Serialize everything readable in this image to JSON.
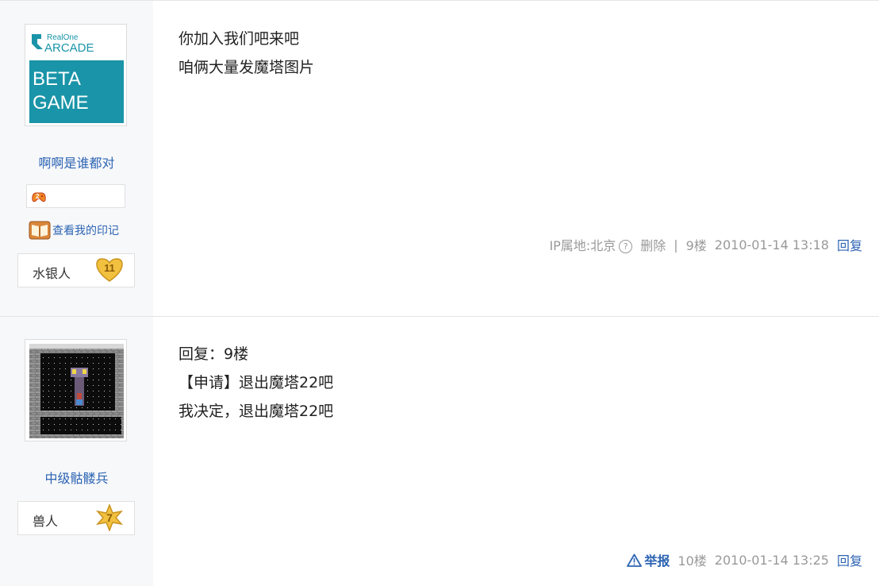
{
  "posts": [
    {
      "username": "啊啊是谁都对",
      "avatar": {
        "logo_line1": "RealOne",
        "logo_line2": "ARCADE",
        "line1": "BETA",
        "line2": "GAME"
      },
      "icon_count": "2",
      "stamp_link": "查看我的印记",
      "level_name": "水银人",
      "level_num": "11",
      "content": [
        "你加入我们吧来吧",
        "咱俩大量发魔塔图片"
      ],
      "tail": {
        "ip": "IP属地:北京",
        "delete": "删除",
        "sep": "|",
        "floor": "9楼",
        "time": "2010-01-14 13:18",
        "reply": "回复"
      }
    },
    {
      "username": "中级骷髅兵",
      "level_name": "兽人",
      "level_num": "7",
      "content": [
        "回复：9楼",
        "【申请】退出魔塔22吧",
        "我决定，退出魔塔22吧"
      ],
      "tail": {
        "report": "举报",
        "floor": "10楼",
        "time": "2010-01-14 13:25",
        "reply": "回复"
      }
    }
  ],
  "colors": {
    "link": "#2d64b3",
    "meta": "#999999",
    "sidebar_bg": "#f7f8fa",
    "avatar_teal": "#1a94a8",
    "badge_gold": "#f1c13f"
  },
  "icons": {
    "avatar1": "realone-arcade-beta-game-avatar",
    "avatar2": "magic-tower-game-avatar",
    "game_icon": "game-controller-icon",
    "stamp_icon": "open-book-icon",
    "level1_badge": "heart-badge-icon",
    "level2_badge": "star-badge-icon",
    "help": "question-circle-icon",
    "report": "warning-triangle-icon"
  }
}
